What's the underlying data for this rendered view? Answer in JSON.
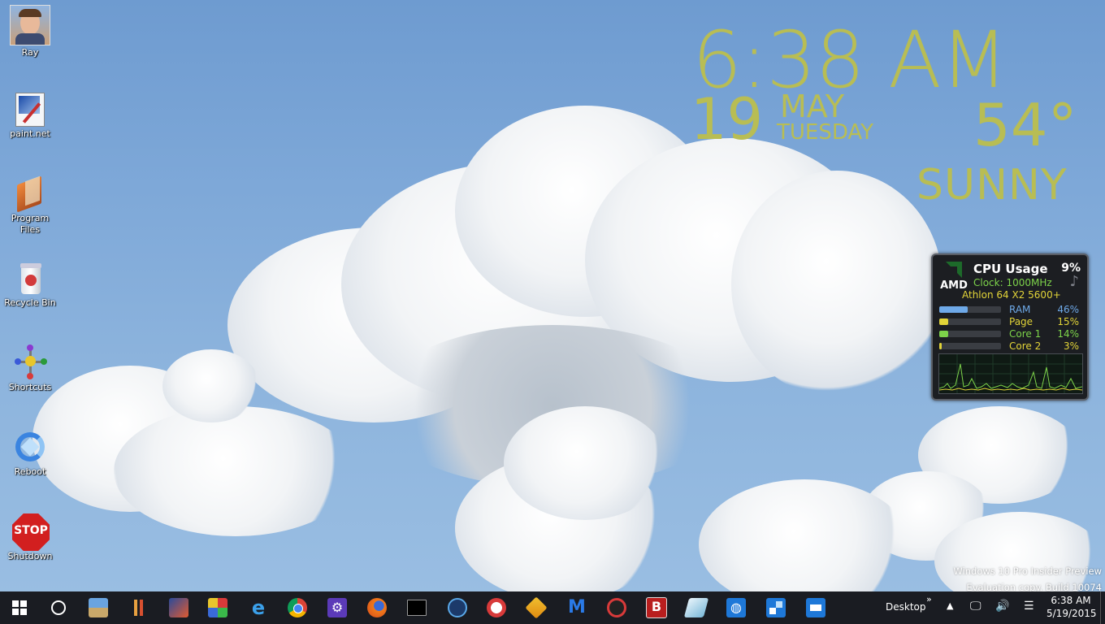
{
  "desktop": {
    "icons": [
      {
        "label": "Ray",
        "icon": "user-photo-icon"
      },
      {
        "label": "paint.net",
        "icon": "paint-net-icon"
      },
      {
        "label": "Program Files",
        "icon": "folder-icon"
      },
      {
        "label": "Recycle Bin",
        "icon": "recycle-bin-icon"
      },
      {
        "label": "Shortcuts",
        "icon": "molecule-icon"
      },
      {
        "label": "Reboot",
        "icon": "recycle-arrows-icon"
      },
      {
        "label": "Shutdown",
        "icon": "stop-sign-icon"
      }
    ]
  },
  "clock_widget": {
    "time": "6:38 AM",
    "day": "19",
    "month": "MAY",
    "weekday": "TUESDAY",
    "temperature": "54°",
    "condition": "SUNNY",
    "color": "#b8bd54"
  },
  "cpu_gadget": {
    "brand": "AMD",
    "title": "CPU Usage",
    "usage": "9%",
    "clock": "Clock: 1000MHz",
    "model": "Athlon 64 X2 5600+",
    "rows": [
      {
        "label": "RAM",
        "value": "46%",
        "level": 0.46,
        "color": "#6ea9e8"
      },
      {
        "label": "Page",
        "value": "15%",
        "level": 0.15,
        "color": "#e2d438"
      },
      {
        "label": "Core 1",
        "value": "14%",
        "level": 0.14,
        "color": "#7dd34a"
      },
      {
        "label": "Core 2",
        "value": "3%",
        "level": 0.03,
        "color": "#e2d438"
      }
    ]
  },
  "watermark": {
    "line1": "Windows 10 Pro Insider Preview",
    "line2": "Evaluation copy. Build 10074"
  },
  "taskbar": {
    "apps": [
      "start-icon",
      "cortana-search-icon",
      "photo-viewer-icon",
      "paint-brushes-icon",
      "pencil-app-icon",
      "color-grid-icon",
      "internet-explorer-icon",
      "chrome-icon",
      "settings-gear-icon",
      "firefox-icon",
      "command-prompt-icon",
      "virtualbox-icon",
      "snipping-tool-icon",
      "lightning-app-icon",
      "malwarebytes-icon",
      "blocked-app-icon",
      "b-app-icon",
      "glass-cube-icon",
      "globe-app-icon",
      "network-app-icon",
      "remote-desktop-icon"
    ],
    "toolbar_label": "Desktop",
    "tray_time": "6:38 AM",
    "tray_date": "5/19/2015"
  }
}
